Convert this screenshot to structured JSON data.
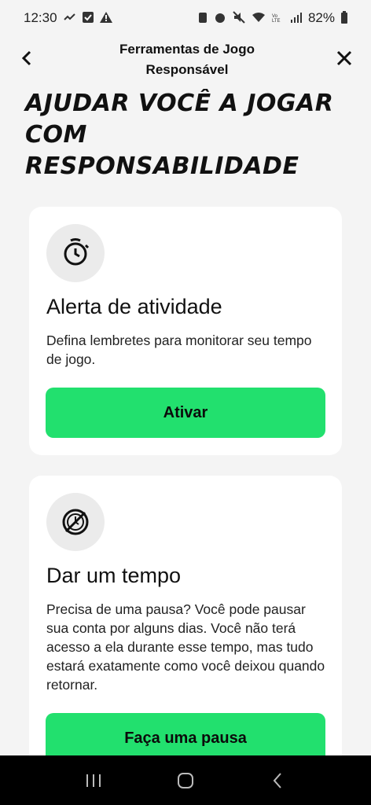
{
  "status": {
    "time": "12:30",
    "battery": "82%"
  },
  "header": {
    "title": "Ferramentas de Jogo Responsável"
  },
  "hero": {
    "title": "AJUDAR VOCÊ A JOGAR COM RESPONSABILIDADE"
  },
  "cards": [
    {
      "title": "Alerta de atividade",
      "description": "Defina lembretes para monitorar seu tempo de jogo.",
      "button": "Ativar",
      "icon": "timer-icon"
    },
    {
      "title": "Dar um tempo",
      "description": "Precisa de uma pausa? Você pode pausar sua conta por alguns dias. Você não terá acesso a ela durante esse tempo, mas tudo estará exatamente como você deixou quando retornar.",
      "button": "Faça uma pausa",
      "icon": "clock-off-icon"
    }
  ],
  "colors": {
    "accent": "#22e06e",
    "background": "#f4f4f4",
    "card": "#ffffff"
  }
}
